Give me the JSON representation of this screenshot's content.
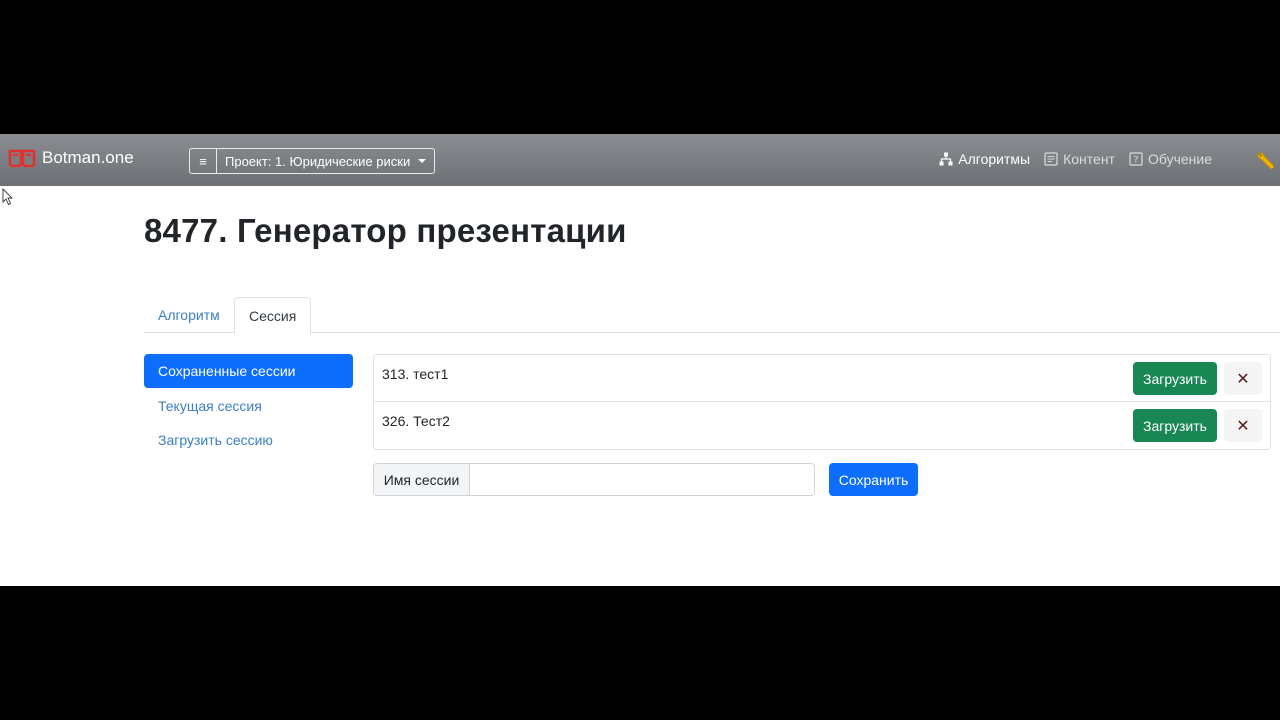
{
  "navbar": {
    "brand": "Botman.one",
    "project_menu_icon": "≡",
    "project_label": "Проект: 1. Юридические риски",
    "links": [
      {
        "label": "Алгоритмы",
        "icon": "sitemap-icon",
        "active": true
      },
      {
        "label": "Контент",
        "icon": "content-icon",
        "active": false
      },
      {
        "label": "Обучение",
        "icon": "help-icon",
        "active": false
      }
    ]
  },
  "page": {
    "title": "8477. Генератор презентации"
  },
  "tabs": [
    {
      "label": "Алгоритм",
      "active": false
    },
    {
      "label": "Сессия",
      "active": true
    }
  ],
  "sidenav": [
    {
      "label": "Сохраненные сессии",
      "active": true
    },
    {
      "label": "Текущая сессия",
      "active": false
    },
    {
      "label": "Загрузить сессию",
      "active": false
    }
  ],
  "sessions": [
    {
      "name": "313. тест1",
      "load_label": "Загрузить",
      "delete_label": "✕"
    },
    {
      "name": "326. Тест2",
      "load_label": "Загрузить",
      "delete_label": "✕"
    }
  ],
  "save": {
    "addon_label": "Имя сессии",
    "input_value": "",
    "button_label": "Сохранить"
  },
  "colors": {
    "primary": "#0d6efd",
    "success": "#198754",
    "brand_red": "#e03131",
    "wrench": "#f0b400"
  }
}
